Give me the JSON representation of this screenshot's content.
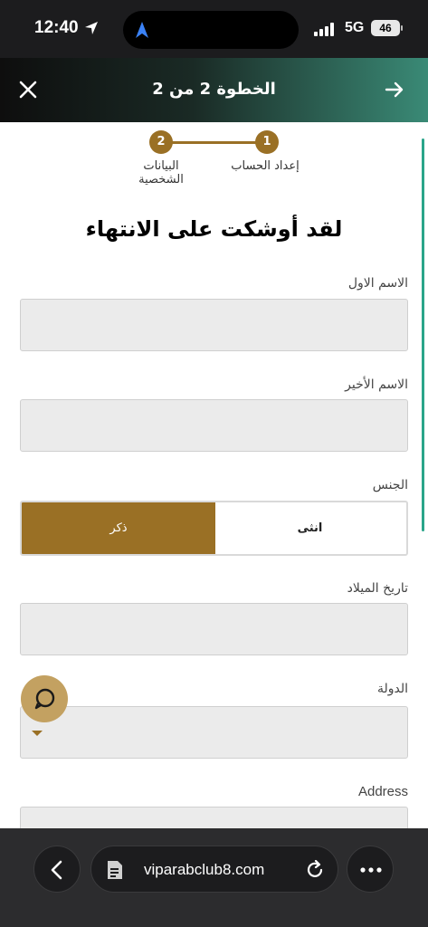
{
  "status_bar": {
    "time": "12:40",
    "network": "5G",
    "battery": "46"
  },
  "header": {
    "title": "الخطوة 2 من 2"
  },
  "stepper": {
    "steps": [
      {
        "number": "1",
        "label": "إعداد الحساب"
      },
      {
        "number": "2",
        "label_line1": "البيانات",
        "label_line2": "الشخصية"
      }
    ]
  },
  "form": {
    "heading": "لقد أوشكت على الانتهاء",
    "first_name_label": "الاسم الاول",
    "last_name_label": "الاسم الأخير",
    "gender_label": "الجنس",
    "gender_male": "ذكر",
    "gender_female": "انثى",
    "gender_selected": "male",
    "dob_label": "تاريخ الميلاد",
    "country_label": "الدولة",
    "address_label": "Address"
  },
  "browser": {
    "url": "viparabclub8.com"
  },
  "colors": {
    "accent_gold": "#9a7025",
    "scroll_teal": "#2aa58a",
    "header_teal": "#3a8a76"
  }
}
